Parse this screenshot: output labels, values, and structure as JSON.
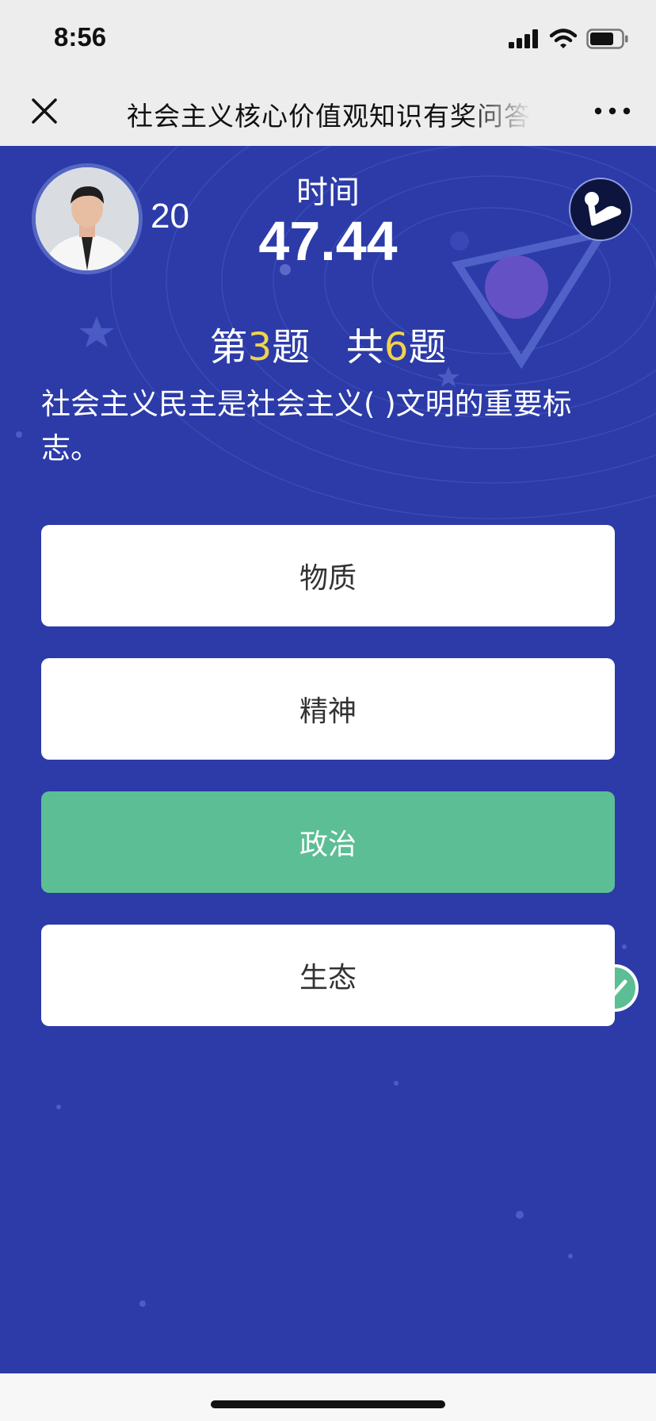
{
  "status": {
    "time": "8:56",
    "icons": [
      "signal-icon",
      "wifi-icon",
      "battery-icon"
    ]
  },
  "nav": {
    "title": "社会主义核心价值观知识有奖问答",
    "close_icon": "close-icon",
    "more_icon": "more-icon"
  },
  "player": {
    "score": "20"
  },
  "timer": {
    "label": "时间",
    "value": "47.44"
  },
  "progress": {
    "prefix": "第",
    "current": "3",
    "middle": "题   共",
    "total": "6",
    "suffix": "题"
  },
  "question": "社会主义民主是社会主义( )文明的重要标志。",
  "options": [
    {
      "label": "物质",
      "state": "default"
    },
    {
      "label": "精神",
      "state": "default"
    },
    {
      "label": "政治",
      "state": "correct"
    },
    {
      "label": "生态",
      "state": "default"
    }
  ],
  "colors": {
    "background": "#2c3ba8",
    "correct": "#5cbe94",
    "highlight": "#f1d34a",
    "option": "#ffffff"
  }
}
